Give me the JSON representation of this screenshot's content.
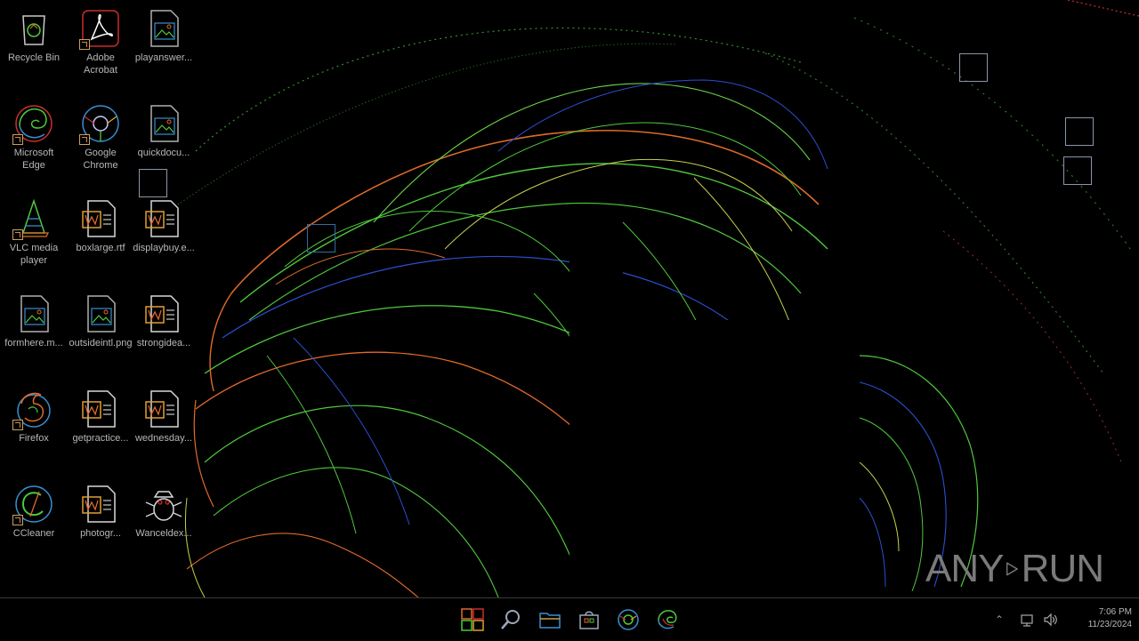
{
  "desktop": {
    "icons": [
      {
        "label": "Recycle Bin",
        "icon": "recycle-bin-icon",
        "shortcut": false
      },
      {
        "label": "Adobe Acrobat",
        "icon": "adobe-acrobat-icon",
        "shortcut": true
      },
      {
        "label": "playanswer...",
        "icon": "image-file-icon",
        "shortcut": false
      },
      {
        "label": "Microsoft Edge",
        "icon": "edge-icon",
        "shortcut": true
      },
      {
        "label": "Google Chrome",
        "icon": "chrome-icon",
        "shortcut": true
      },
      {
        "label": "quickdocu...",
        "icon": "image-file-icon",
        "shortcut": false
      },
      {
        "label": "VLC media player",
        "icon": "vlc-icon",
        "shortcut": true
      },
      {
        "label": "boxlarge.rtf",
        "icon": "word-doc-icon",
        "shortcut": false
      },
      {
        "label": "displaybuy.e...",
        "icon": "word-doc-icon",
        "shortcut": false
      },
      {
        "label": "formhere.m...",
        "icon": "image-file-icon",
        "shortcut": false
      },
      {
        "label": "outsideintl.png",
        "icon": "image-file-icon",
        "shortcut": false
      },
      {
        "label": "strongidea...",
        "icon": "word-doc-icon",
        "shortcut": false
      },
      {
        "label": "Firefox",
        "icon": "firefox-icon",
        "shortcut": true
      },
      {
        "label": "getpractice...",
        "icon": "word-doc-icon",
        "shortcut": false
      },
      {
        "label": "wednesday...",
        "icon": "word-doc-icon",
        "shortcut": false
      },
      {
        "label": "CCleaner",
        "icon": "ccleaner-icon",
        "shortcut": true
      },
      {
        "label": "photogr...",
        "icon": "word-doc-icon",
        "shortcut": false
      },
      {
        "label": "Wanceldex...",
        "icon": "bug-app-icon",
        "shortcut": false
      }
    ]
  },
  "taskbar": {
    "apps": [
      {
        "name": "start-button",
        "icon": "windows-logo-icon"
      },
      {
        "name": "search-button",
        "icon": "search-icon"
      },
      {
        "name": "file-explorer-button",
        "icon": "folder-icon"
      },
      {
        "name": "store-button",
        "icon": "store-icon"
      },
      {
        "name": "chrome-taskbar-button",
        "icon": "chrome-icon"
      },
      {
        "name": "edge-taskbar-button",
        "icon": "edge-icon"
      }
    ],
    "clock": {
      "time": "7:06 PM",
      "date": "11/23/2024"
    }
  },
  "watermark": {
    "left": "ANY",
    "right": "RUN"
  },
  "colors": {
    "label_text": "#b7b7b7",
    "accent_orange": "#e06a2a",
    "accent_green": "#4fc93c",
    "accent_blue": "#2a4fd0",
    "accent_red": "#c8302a"
  }
}
